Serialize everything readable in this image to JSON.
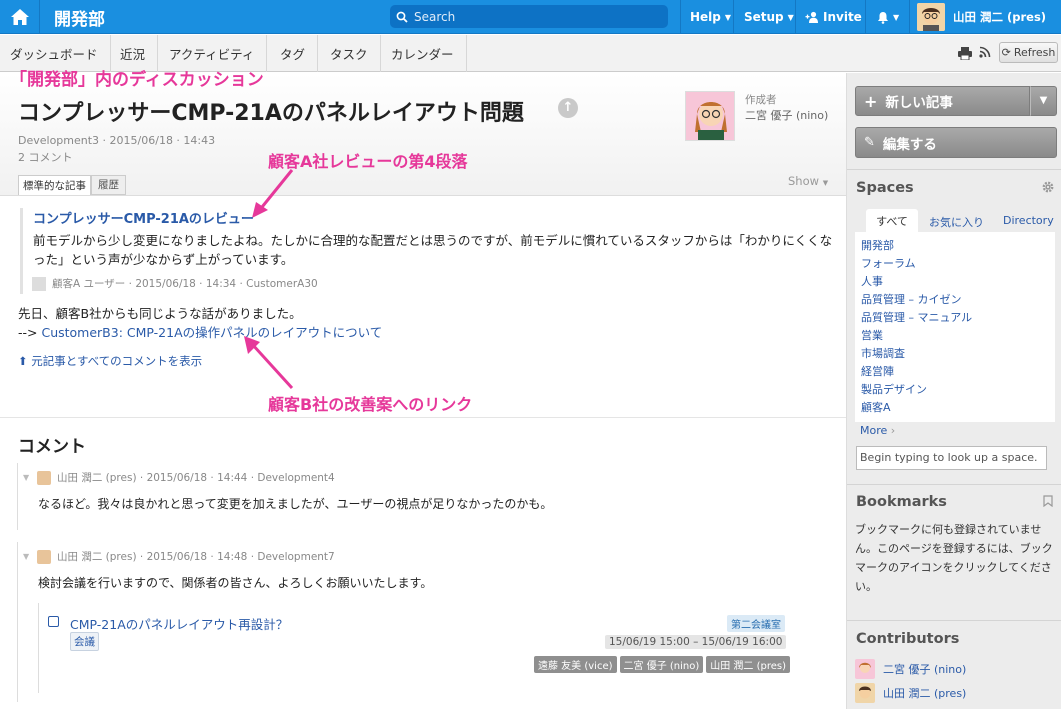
{
  "topbar": {
    "group_name": "開発部",
    "search_placeholder": "Search",
    "help": "Help",
    "setup": "Setup",
    "invite": "Invite",
    "user": "山田 潤二 (pres)"
  },
  "subnav": {
    "items": [
      "ダッシュボード",
      "近況",
      "アクティビティ",
      "タグ",
      "タスク",
      "カレンダー"
    ],
    "refresh": "Refresh"
  },
  "article": {
    "space_caption": "「開発部」内のディスカッション",
    "title": "コンプレッサーCMP-21Aのパネルレイアウト問題",
    "meta": "Development3 · 2015/06/18 · 14:43",
    "comment_count": "2 コメント",
    "author_label": "作成者",
    "author_name": "二宮 優子 (nino)",
    "tab_standard": "標準的な記事",
    "tab_history": "履歴",
    "show": "Show",
    "callout_top": "顧客A社レビューの第4段落",
    "quote_title": "コンプレッサーCMP-21Aのレビュー",
    "quote_body": "前モデルから少し変更になりましたよね。たしかに合理的な配置だとは思うのですが、前モデルに慣れているスタッフからは「わかりにくくなった」という声が少なからず上がっています。",
    "quote_meta": "顧客A ユーザー · 2015/06/18 · 14:34 · CustomerA30",
    "para1": "先日、顧客B社からも同じような話がありました。",
    "para2_prefix": "--> ",
    "para2_link": "CustomerB3: CMP-21Aの操作パネルのレイアウトについて",
    "show_all": "元記事とすべてのコメントを表示",
    "callout_bottom": "顧客B社の改善案へのリンク"
  },
  "comments": {
    "heading": "コメント",
    "items": [
      {
        "meta": "山田 潤二 (pres) · 2015/06/18 · 14:44 · Development4",
        "body": "なるほど。我々は良かれと思って変更を加えましたが、ユーザーの視点が足りなかったのかも。"
      },
      {
        "meta": "山田 潤二 (pres) · 2015/06/18 · 14:48 · Development7",
        "body": "検討会議を行いますので、関係者の皆さん、よろしくお願いいたします。"
      }
    ],
    "event": {
      "title": "CMP-21Aのパネルレイアウト再設計？",
      "tag": "会議",
      "room": "第二会議室",
      "time": "15/06/19 15:00 – 15/06/19 16:00",
      "people": [
        "遠藤 友美 (vice)",
        "二宮 優子 (nino)",
        "山田 潤二 (pres)"
      ]
    }
  },
  "sidebar": {
    "new_post": "新しい記事",
    "edit": "編集する",
    "spaces_heading": "Spaces",
    "tabs": [
      "すべて",
      "お気に入り",
      "Directory"
    ],
    "spaces": [
      "開発部",
      "フォーラム",
      "人事",
      "品質管理 – カイゼン",
      "品質管理 – マニュアル",
      "営業",
      "市場調査",
      "経営陣",
      "製品デザイン",
      "顧客A"
    ],
    "more": "More",
    "space_input_placeholder": "Begin typing to look up a space.",
    "bookmarks_heading": "Bookmarks",
    "bookmarks_text": "ブックマークに何も登録されていません。このページを登録するには、ブックマークのアイコンをクリックしてください。",
    "contributors_heading": "Contributors",
    "contributors": [
      "二宮 優子 (nino)",
      "山田 潤二 (pres)"
    ]
  },
  "colors": {
    "topbar": "#1a8fe0",
    "accent_pink": "#e6389a",
    "link": "#2a5aa8"
  }
}
